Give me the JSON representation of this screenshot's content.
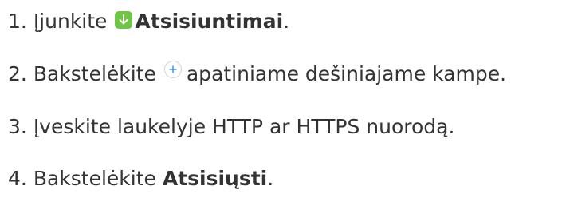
{
  "steps": [
    {
      "number": "1.",
      "text_before": "Įjunkite",
      "icon": "download-icon",
      "bold_text": "Atsisiuntimai",
      "text_after": "."
    },
    {
      "number": "2.",
      "text_before": "Bakstelėkite",
      "icon": "plus-circle-icon",
      "text_after": "apatiniame dešiniajame kampe."
    },
    {
      "number": "3.",
      "text": "Įveskite laukelyje HTTP ar HTTPS nuorodą."
    },
    {
      "number": "4.",
      "text_before": "Bakstelėkite",
      "bold_text": "Atsisiųsti",
      "text_after": "."
    }
  ],
  "colors": {
    "text": "#333333",
    "download_icon_bg": "#6fc544",
    "plus_icon": "#2f80ed"
  }
}
